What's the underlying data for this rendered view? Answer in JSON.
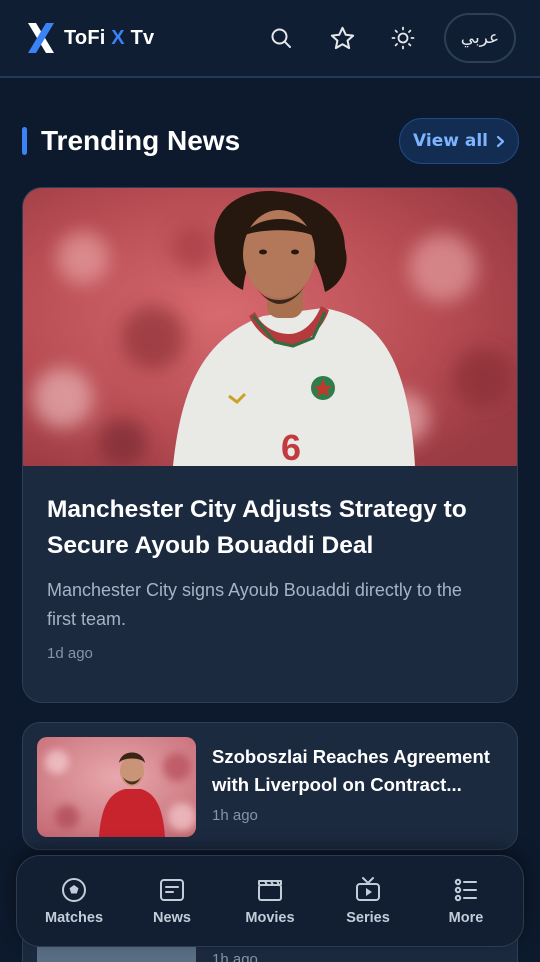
{
  "header": {
    "brand_part1": "ToFi ",
    "brand_x": "X",
    "brand_part2": " Tv",
    "icons": [
      "search-icon",
      "star-icon",
      "sun-icon"
    ],
    "language_button": "عربي"
  },
  "trending": {
    "title": "Trending News",
    "view_all": "View all"
  },
  "featured": {
    "title": "Manchester City Adjusts Strategy to Secure Ayoub Bouaddi Deal",
    "description": "Manchester City signs Ayoub Bouaddi directly to the first team.",
    "time": "1d ago",
    "jersey_number": "6"
  },
  "articles": [
    {
      "title": "Szoboszlai Reaches Agreement with Liverpool on Contract...",
      "time": "1h ago"
    },
    {
      "title": "",
      "time": "1h ago"
    }
  ],
  "bottom_nav": [
    {
      "label": "Matches",
      "icon": "football-icon"
    },
    {
      "label": "News",
      "icon": "news-icon"
    },
    {
      "label": "Movies",
      "icon": "clapperboard-icon"
    },
    {
      "label": "Series",
      "icon": "tv-icon"
    },
    {
      "label": "More",
      "icon": "list-icon"
    }
  ],
  "colors": {
    "background": "#0d1a2d",
    "accent": "#3b82f6",
    "card": "#1c2a40"
  }
}
